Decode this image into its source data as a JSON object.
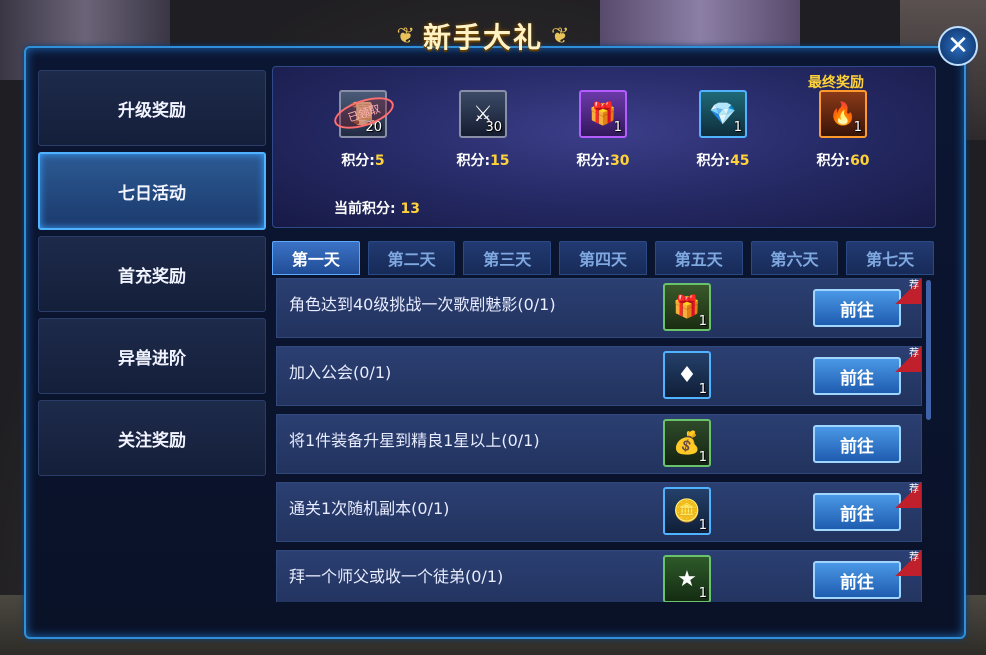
{
  "window": {
    "title": "新手大礼",
    "close_label": "✕"
  },
  "sidebar": {
    "items": [
      {
        "label": "升级奖励",
        "active": false
      },
      {
        "label": "七日活动",
        "active": true
      },
      {
        "label": "首充奖励",
        "active": false
      },
      {
        "label": "异兽进阶",
        "active": false
      },
      {
        "label": "关注奖励",
        "active": false
      }
    ]
  },
  "rewards": {
    "final_label": "最终奖励",
    "score_prefix": "积分:",
    "claimed_stamp": "已领取",
    "items": [
      {
        "icon": "scroll-icon",
        "count": "20",
        "score": "5",
        "claimed": true,
        "border": "#8a8fa8"
      },
      {
        "icon": "claw-icon",
        "count": "30",
        "score": "15",
        "claimed": false,
        "border": "#8a8fa8"
      },
      {
        "icon": "chest-scroll-icon",
        "count": "1",
        "score": "30",
        "claimed": false,
        "border": "#b45cff"
      },
      {
        "icon": "crystal-icon",
        "count": "1",
        "score": "45",
        "claimed": false,
        "border": "#4fb3ff"
      },
      {
        "icon": "mount-egg-icon",
        "count": "1",
        "score": "60",
        "claimed": false,
        "border": "#ff9a2a"
      }
    ],
    "current_label": "当前积分:",
    "current_value": "13"
  },
  "tabs": [
    {
      "label": "第一天",
      "active": true
    },
    {
      "label": "第二天",
      "active": false
    },
    {
      "label": "第三天",
      "active": false
    },
    {
      "label": "第四天",
      "active": false
    },
    {
      "label": "第五天",
      "active": false
    },
    {
      "label": "第六天",
      "active": false
    },
    {
      "label": "第七天",
      "active": false
    }
  ],
  "tasks": [
    {
      "text": "角色达到40级挑战一次歌剧魅影(0/1)",
      "icon": "gift-box-icon",
      "count": "1",
      "button": "前往",
      "recommended": true
    },
    {
      "text": "加入公会(0/1)",
      "icon": "ruby-gem-icon",
      "count": "1",
      "button": "前往",
      "recommended": true
    },
    {
      "text": "将1件装备升星到精良1星以上(0/1)",
      "icon": "money-bag-icon",
      "count": "1",
      "button": "前往",
      "recommended": false
    },
    {
      "text": "通关1次随机副本(0/1)",
      "icon": "gold-coin-icon",
      "count": "1",
      "button": "前往",
      "recommended": true
    },
    {
      "text": "拜一个师父或收一个徒弟(0/1)",
      "icon": "experience-badge-icon",
      "count": "1",
      "button": "前往",
      "recommended": true
    }
  ],
  "recommend_badge": "荐",
  "colors": {
    "accent_blue": "#2f8fd8",
    "score_gold": "#ffd23a",
    "button_blue": "#1f5cb0"
  }
}
